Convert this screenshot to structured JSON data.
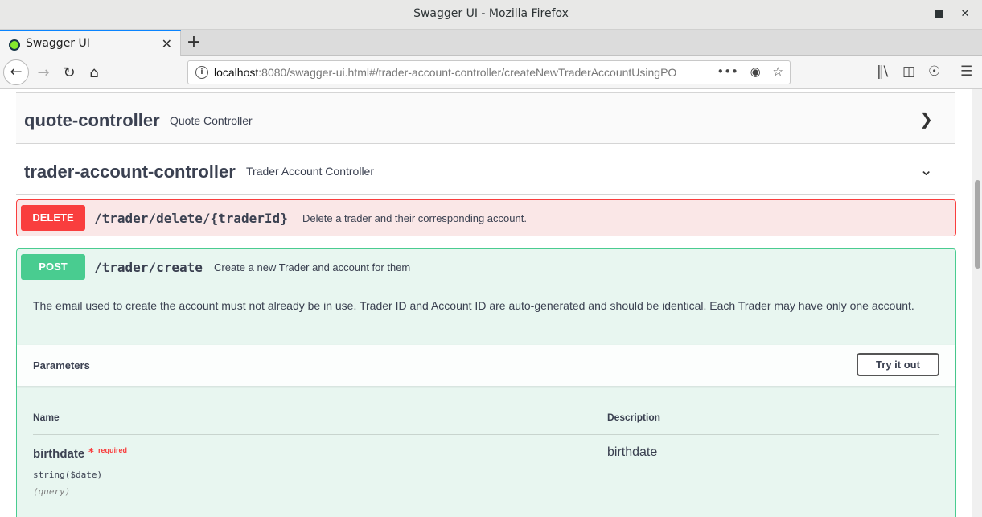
{
  "window": {
    "title": "Swagger UI - Mozilla Firefox"
  },
  "tab": {
    "title": "Swagger UI"
  },
  "urlbar": {
    "host": "localhost",
    "rest": ":8080/swagger-ui.html#/trader-account-controller/createNewTraderAccountUsingPO"
  },
  "tags": [
    {
      "name": "quote-controller",
      "description": "Quote Controller",
      "expanded": false
    },
    {
      "name": "trader-account-controller",
      "description": "Trader Account Controller",
      "expanded": true
    }
  ],
  "operations": {
    "delete": {
      "method": "DELETE",
      "path": "/trader/delete/{traderId}",
      "summary": "Delete a trader and their corresponding account."
    },
    "post": {
      "method": "POST",
      "path": "/trader/create",
      "summary": "Create a new Trader and account for them",
      "description": "The email used to create the account must not already be in use. Trader ID and Account ID are auto-generated and should be identical. Each Trader may have only one account.",
      "parameters_title": "Parameters",
      "try_label": "Try it out",
      "columns": {
        "name": "Name",
        "description": "Description"
      },
      "params": [
        {
          "name": "birthdate",
          "required_mark": "*",
          "required_label": "required",
          "type": "string($date)",
          "in": "(query)",
          "description": "birthdate"
        }
      ]
    }
  },
  "colors": {
    "delete": "#f93e3e",
    "post": "#49cc90",
    "text": "#3b4151",
    "accent": "#0a84ff"
  }
}
